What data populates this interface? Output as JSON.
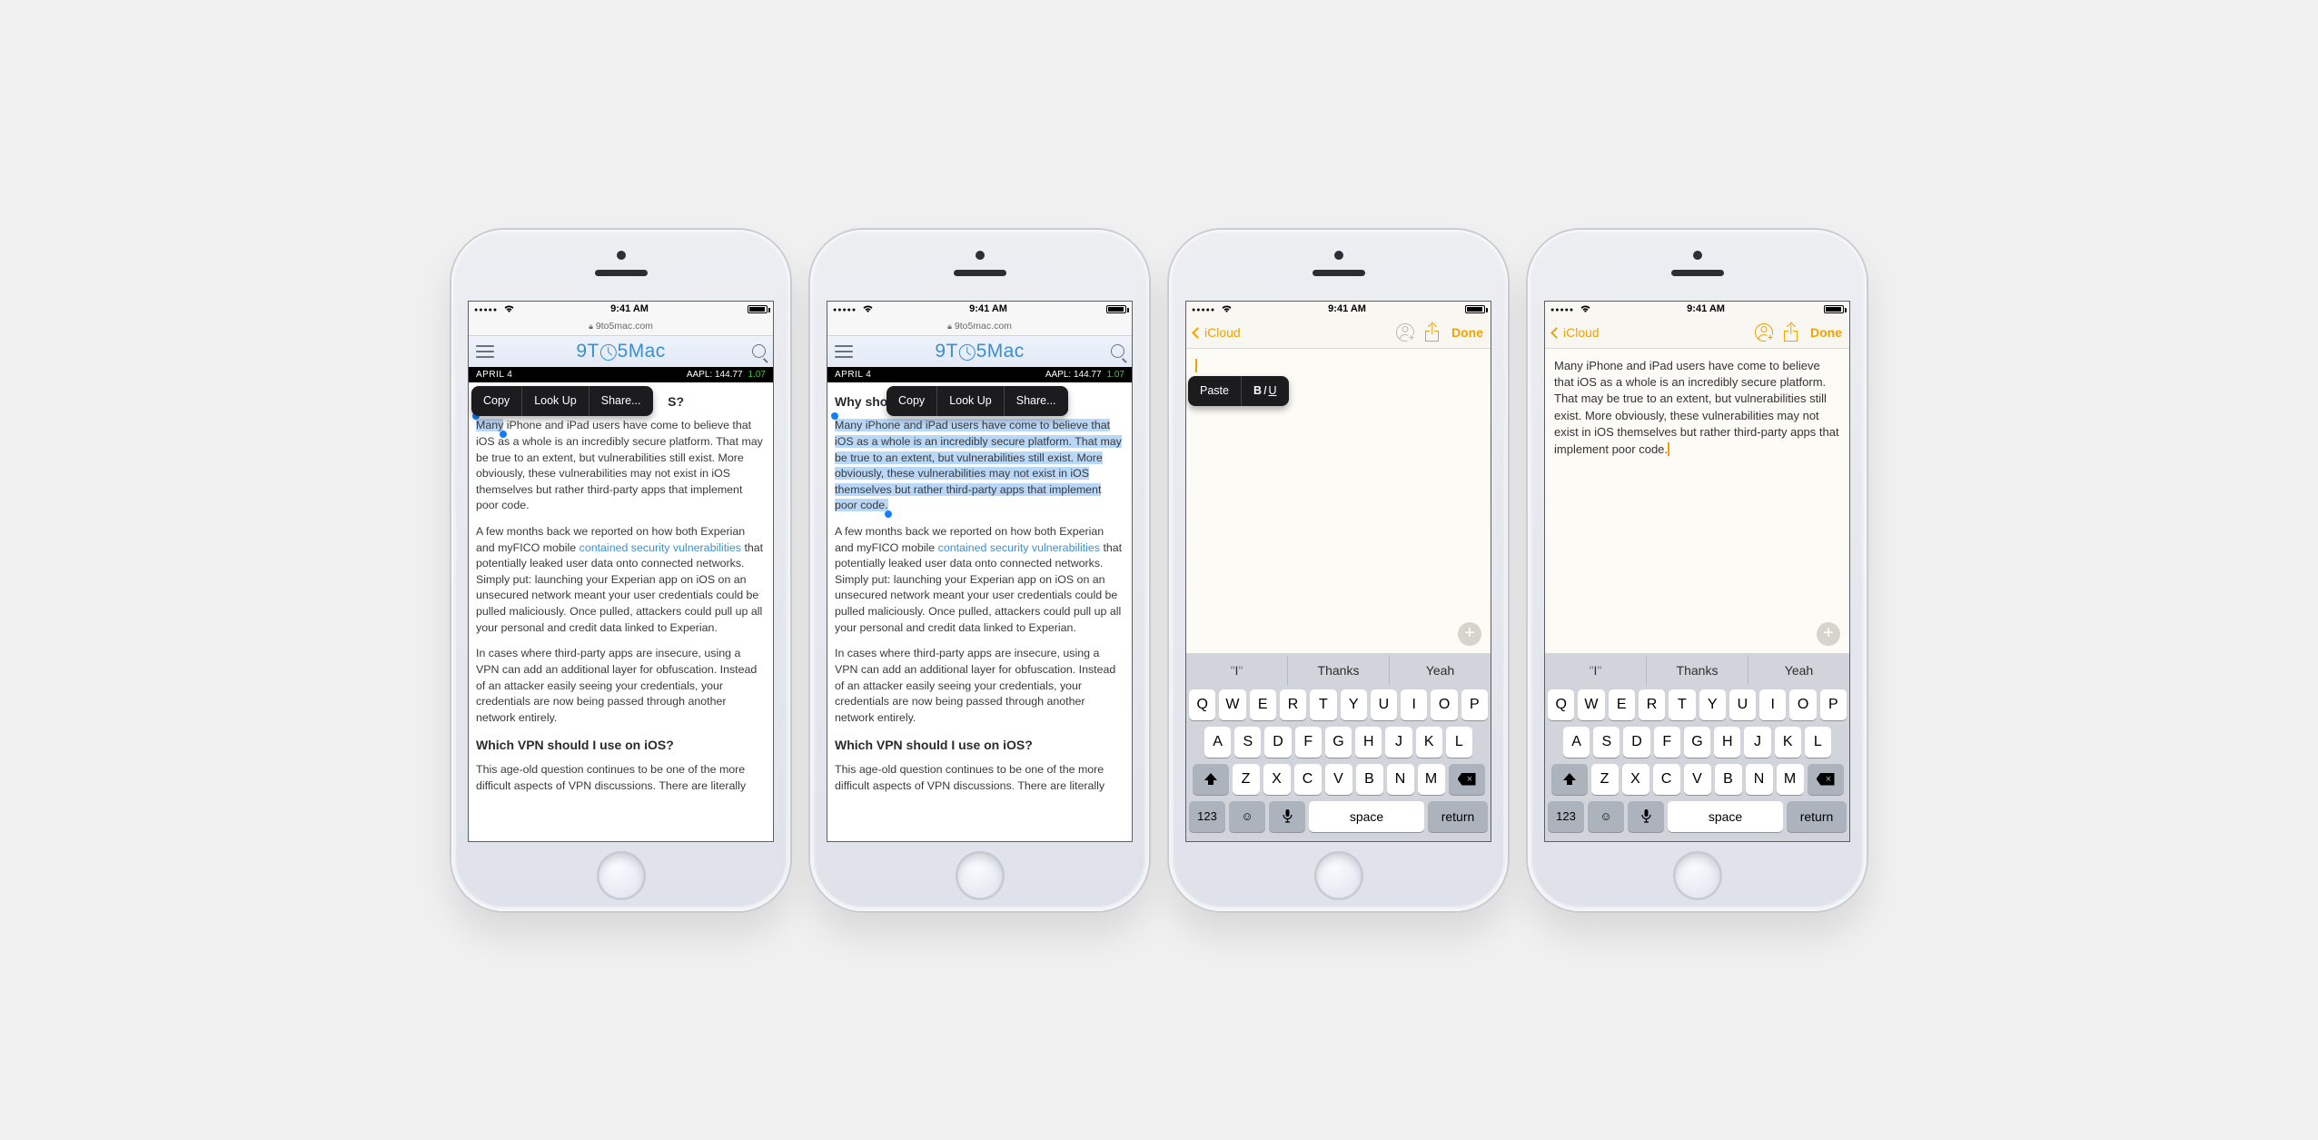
{
  "status": {
    "time": "9:41 AM"
  },
  "safari": {
    "domain": "9to5mac.com",
    "site_name_1": "9T",
    "site_name_2": "5",
    "site_name_3": "Mac"
  },
  "ticker": {
    "date": "APRIL 4",
    "symbol": "AAPL: 144.77",
    "change": "1.07"
  },
  "article": {
    "h1_partial_1": "S?",
    "h1_full": "Why shou",
    "selected_word": "Many",
    "p1_rest_after_many": " iPhone and iPad users have come to believe that iOS as a whole is an incredibly secure platform. That may be true to an extent, but vulnerabilities still exist. More obviously, these vulnerabilities may not exist in iOS themselves but rather third-party apps that implement poor code.",
    "p1_full": "Many iPhone and iPad users have come to believe that iOS as a whole is an incredibly secure platform. That may be true to an extent, but vulnerabilities still exist. More obviously, these vulnerabilities may not exist in iOS themselves but rather third-party apps that implement poor code.",
    "p2_a": "A few months back we reported on how both Experian and myFICO mobile ",
    "p2_link": "contained security vulnerabilities",
    "p2_b": " that potentially leaked user data onto connected networks. Simply put: launching your Experian app on iOS on an unsecured network meant your user credentials could be pulled maliciously. Once pulled, attackers could pull up all your personal and credit data linked to Experian.",
    "p3": "In cases where third-party apps are insecure, using a VPN can add an additional layer for obfuscation. Instead of an attacker easily seeing your credentials, your credentials are now being passed through another network entirely.",
    "h2": "Which VPN should I use on iOS?",
    "p4": "This age-old question continues to be one of the more difficult aspects of VPN discussions. There are literally"
  },
  "popover_safari": {
    "copy": "Copy",
    "lookup": "Look Up",
    "share": "Share..."
  },
  "notes": {
    "back_label": "iCloud",
    "done": "Done",
    "pasted_text": "Many iPhone and iPad users have come to believe that iOS as a whole is an incredibly secure platform. That may be true to an extent, but vulnerabilities still exist. More obviously, these vulnerabilities may not exist in iOS themselves but rather third-party apps that implement poor code."
  },
  "popover_notes": {
    "paste": "Paste",
    "biu": "B I U"
  },
  "keyboard": {
    "suggest": [
      "I",
      "Thanks",
      "Yeah"
    ],
    "row1": [
      "Q",
      "W",
      "E",
      "R",
      "T",
      "Y",
      "U",
      "I",
      "O",
      "P"
    ],
    "row2": [
      "A",
      "S",
      "D",
      "F",
      "G",
      "H",
      "J",
      "K",
      "L"
    ],
    "row3": [
      "Z",
      "X",
      "C",
      "V",
      "B",
      "N",
      "M"
    ],
    "k123": "123",
    "space": "space",
    "return": "return"
  }
}
